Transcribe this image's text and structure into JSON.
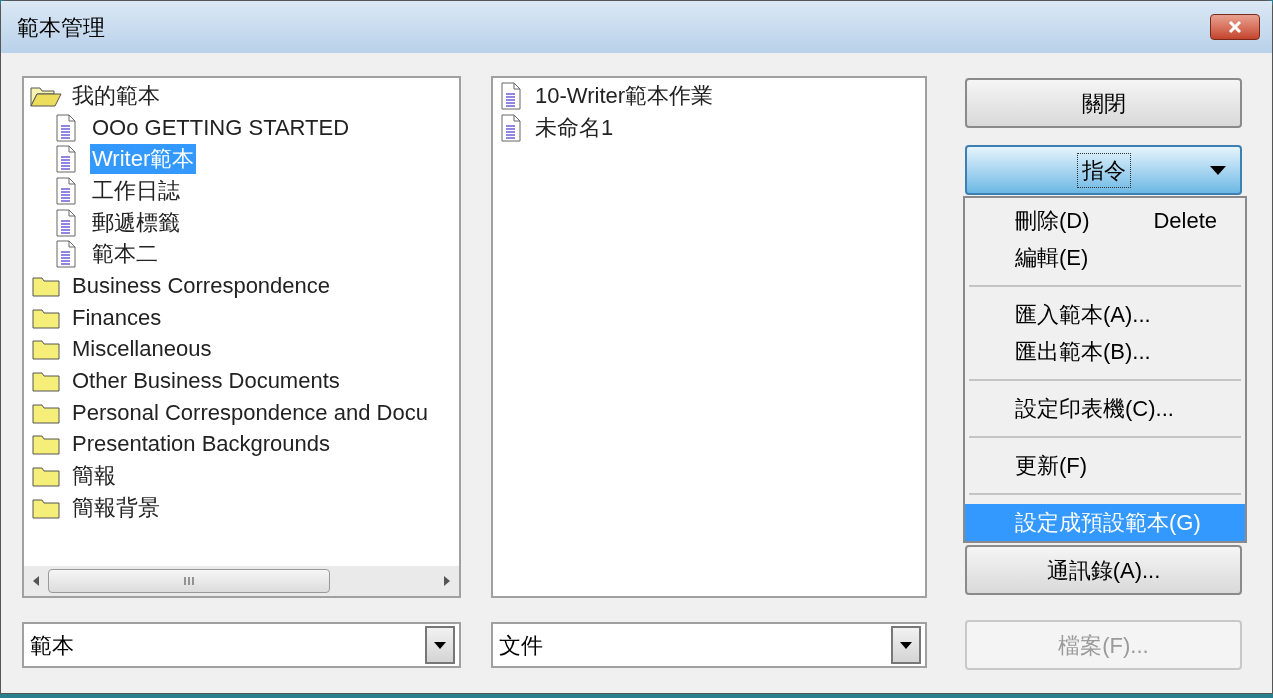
{
  "window": {
    "title": "範本管理"
  },
  "categories_tree": [
    {
      "label": "我的範本",
      "kind": "folder",
      "expanded": true,
      "selected": false,
      "children": [
        {
          "label": "OOo GETTING STARTED",
          "kind": "document",
          "selected": false
        },
        {
          "label": "Writer範本",
          "kind": "document",
          "selected": true
        },
        {
          "label": "工作日誌",
          "kind": "document",
          "selected": false
        },
        {
          "label": "郵遞標籤",
          "kind": "document",
          "selected": false
        },
        {
          "label": "範本二",
          "kind": "document",
          "selected": false
        }
      ]
    },
    {
      "label": "Business Correspondence",
      "kind": "folder",
      "expanded": false,
      "selected": false
    },
    {
      "label": "Finances",
      "kind": "folder",
      "expanded": false,
      "selected": false
    },
    {
      "label": "Miscellaneous",
      "kind": "folder",
      "expanded": false,
      "selected": false
    },
    {
      "label": "Other Business Documents",
      "kind": "folder",
      "expanded": false,
      "selected": false
    },
    {
      "label": "Personal Correspondence and Docu",
      "kind": "folder",
      "expanded": false,
      "selected": false
    },
    {
      "label": "Presentation Backgrounds",
      "kind": "folder",
      "expanded": false,
      "selected": false
    },
    {
      "label": "簡報",
      "kind": "folder",
      "expanded": false,
      "selected": false
    },
    {
      "label": "簡報背景",
      "kind": "folder",
      "expanded": false,
      "selected": false
    }
  ],
  "templates_list": [
    {
      "label": "10-Writer範本作業",
      "selected": false
    },
    {
      "label": "未命名1",
      "selected": false
    }
  ],
  "left_dropdown": {
    "value": "範本"
  },
  "right_dropdown": {
    "value": "文件"
  },
  "buttons": [
    {
      "label": "關閉",
      "kind": "push",
      "disabled": false,
      "hot": false
    },
    {
      "label": "指令",
      "kind": "menu",
      "disabled": false,
      "hot": true
    },
    {
      "label": "通訊錄(A)...",
      "kind": "push",
      "disabled": false,
      "hot": false
    },
    {
      "label": "檔案(F)...",
      "kind": "push",
      "disabled": true,
      "hot": false
    }
  ],
  "commands_menu": [
    {
      "kind": "item",
      "label": "刪除(D)",
      "shortcut": "Delete",
      "selected": false
    },
    {
      "kind": "item",
      "label": "編輯(E)",
      "selected": false
    },
    {
      "kind": "separator"
    },
    {
      "kind": "item",
      "label": "匯入範本(A)...",
      "selected": false
    },
    {
      "kind": "item",
      "label": "匯出範本(B)...",
      "selected": false
    },
    {
      "kind": "separator"
    },
    {
      "kind": "item",
      "label": "設定印表機(C)...",
      "selected": false
    },
    {
      "kind": "separator"
    },
    {
      "kind": "item",
      "label": "更新(F)",
      "selected": false
    },
    {
      "kind": "separator"
    },
    {
      "kind": "item",
      "label": "設定成預設範本(G)",
      "selected": true
    }
  ]
}
